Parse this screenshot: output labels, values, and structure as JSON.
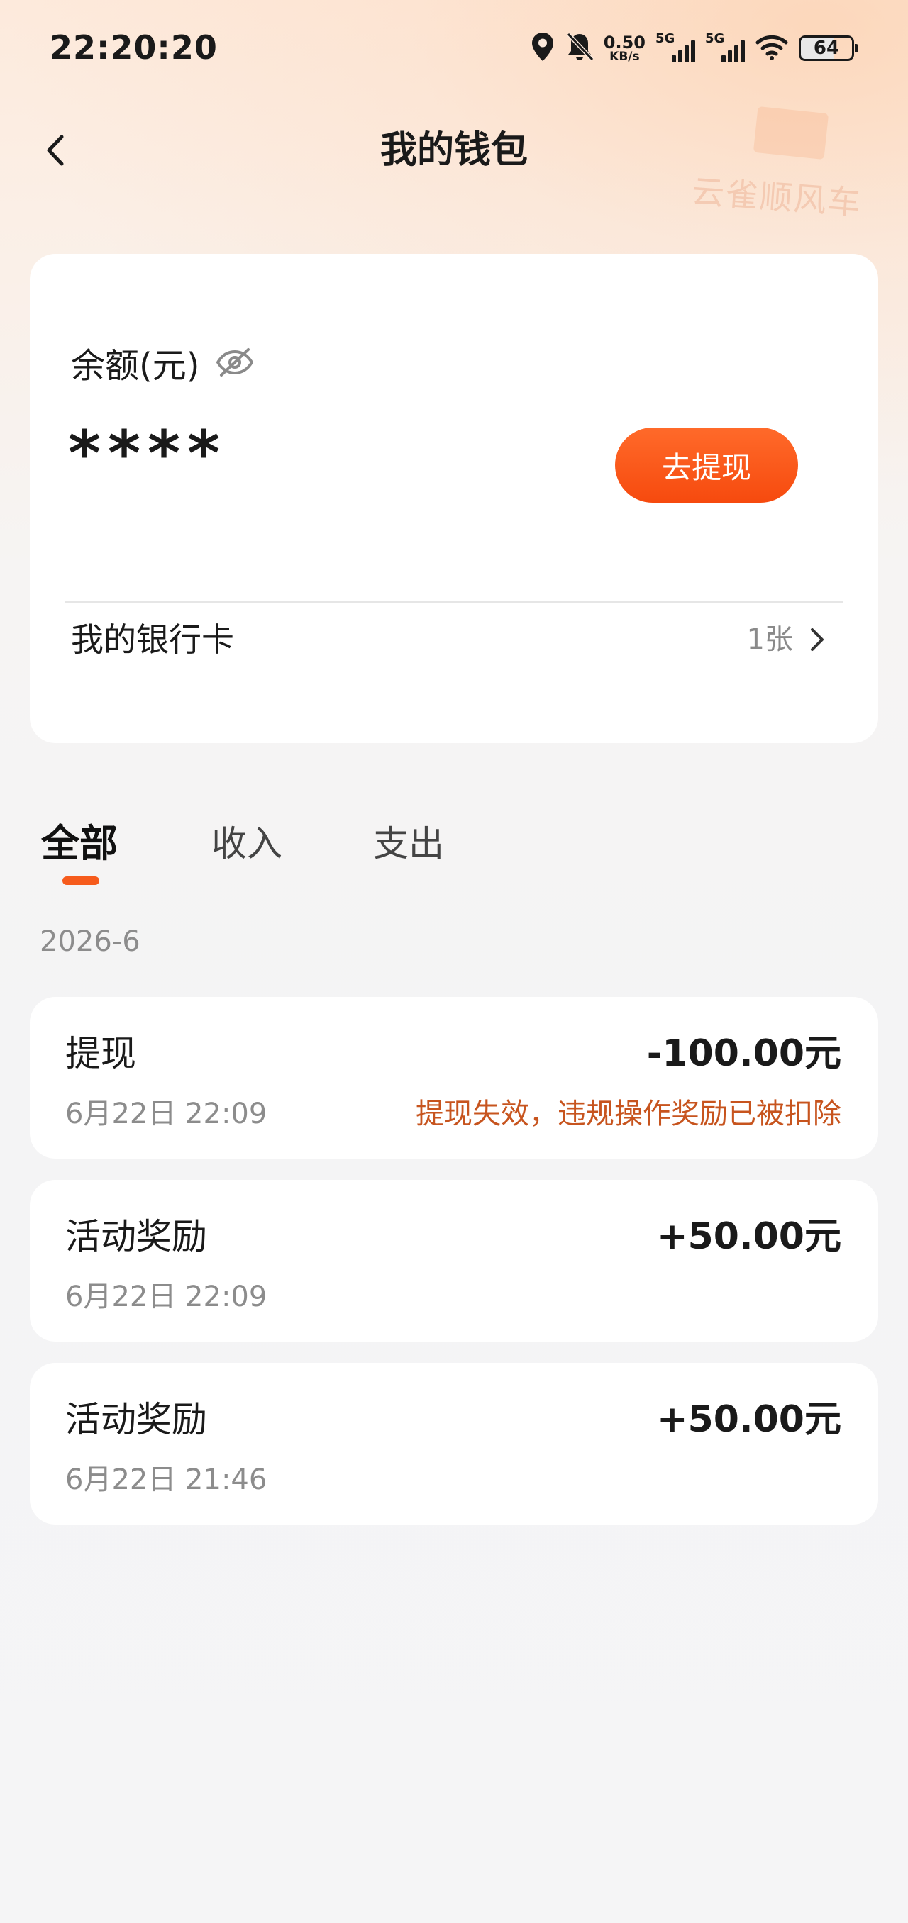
{
  "status_bar": {
    "time": "22:20:20",
    "net_speed_value": "0.50",
    "net_speed_unit": "KB/s",
    "signal1_label": "5G",
    "signal2_label": "5G",
    "battery": "64",
    "icons": [
      "location-icon",
      "bell-muted-icon",
      "signal-icon",
      "signal-icon",
      "wifi-icon",
      "battery-icon"
    ]
  },
  "header": {
    "title": "我的钱包",
    "back_icon": "back-chevron-icon"
  },
  "watermark": "云雀顺风车",
  "balance": {
    "label": "余额(元)",
    "amount_masked": "****",
    "visibility_icon": "eye-hidden-icon",
    "withdraw_label": "去提现",
    "accent_color": "#f65b1c"
  },
  "bank": {
    "label": "我的银行卡",
    "count": "1张"
  },
  "tabs": [
    {
      "label": "全部",
      "active": true
    },
    {
      "label": "收入",
      "active": false
    },
    {
      "label": "支出",
      "active": false
    }
  ],
  "month": "2026-6",
  "transactions": [
    {
      "title": "提现",
      "amount": "-100.00元",
      "time": "6月22日 22:09",
      "note": "提现失效，违规操作奖励已被扣除"
    },
    {
      "title": "活动奖励",
      "amount": "+50.00元",
      "time": "6月22日 22:09",
      "note": ""
    },
    {
      "title": "活动奖励",
      "amount": "+50.00元",
      "time": "6月22日 21:46",
      "note": ""
    }
  ]
}
